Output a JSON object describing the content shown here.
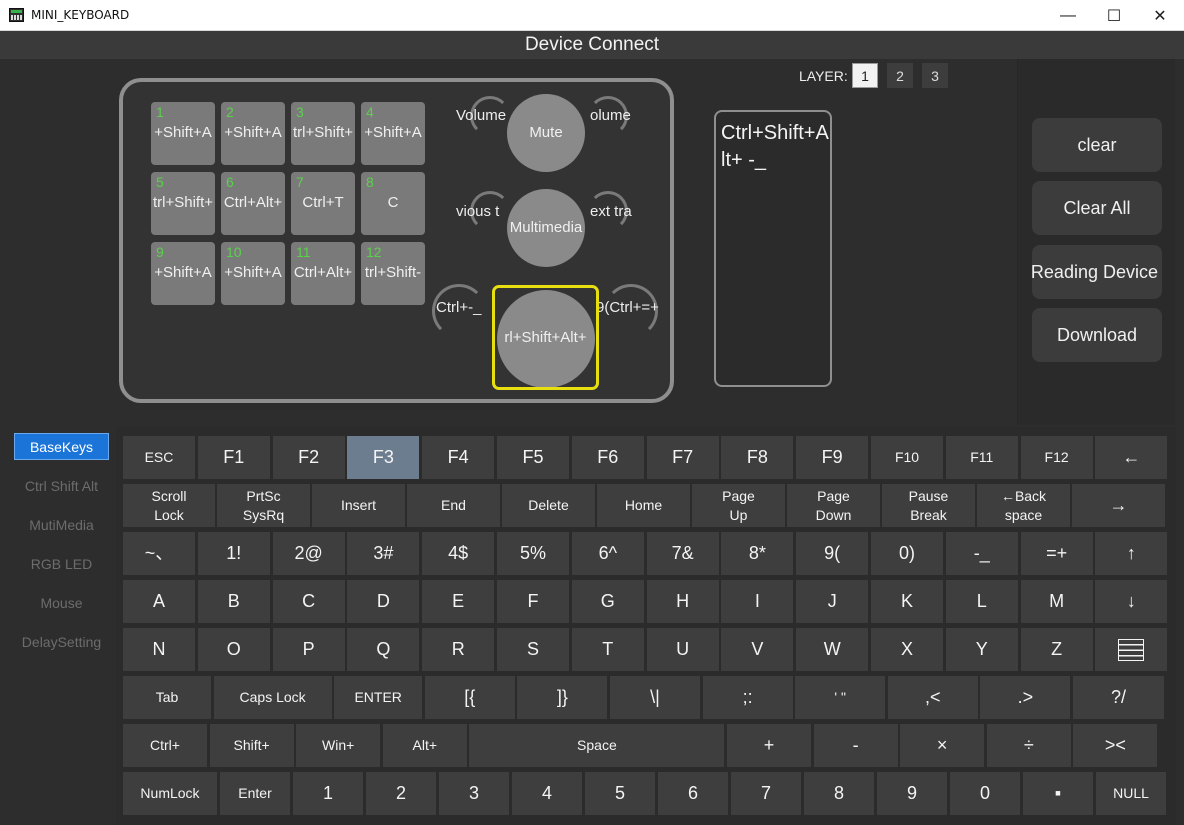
{
  "window": {
    "title": "MINI_KEYBOARD",
    "controls": {
      "minimize": "—",
      "maximize": "☐",
      "close": "✕"
    }
  },
  "header": {
    "title": "Device Connect"
  },
  "layer": {
    "label": "LAYER:",
    "options": [
      "1",
      "2",
      "3"
    ],
    "selected": "1"
  },
  "device": {
    "keys": [
      {
        "num": "1",
        "label": "+Shift+A"
      },
      {
        "num": "2",
        "label": "+Shift+A"
      },
      {
        "num": "3",
        "label": "trl+Shift+"
      },
      {
        "num": "4",
        "label": "+Shift+A"
      },
      {
        "num": "5",
        "label": "trl+Shift+"
      },
      {
        "num": "6",
        "label": "Ctrl+Alt+"
      },
      {
        "num": "7",
        "label": "Ctrl+T"
      },
      {
        "num": "8",
        "label": "C"
      },
      {
        "num": "9",
        "label": "+Shift+A"
      },
      {
        "num": "10",
        "label": "+Shift+A"
      },
      {
        "num": "11",
        "label": "Ctrl+Alt+"
      },
      {
        "num": "12",
        "label": "trl+Shift-"
      }
    ],
    "knobs": [
      {
        "left": "Volume",
        "center": "Mute",
        "right": "olume"
      },
      {
        "left": "vious t",
        "center": "Multimedia",
        "right": "ext tra"
      },
      {
        "left": "Ctrl+-_",
        "center": "rl+Shift+Alt+",
        "right": "9(Ctrl+=+"
      }
    ]
  },
  "preview": {
    "text": "Ctrl+Shift+Alt+ -_"
  },
  "actions": {
    "clear": "clear",
    "clear_all": "Clear All",
    "reading": "Reading Device",
    "download": "Download"
  },
  "sidebar": {
    "items": [
      "BaseKeys",
      "Ctrl Shift Alt",
      "MutiMedia",
      "RGB LED",
      "Mouse",
      "DelaySetting"
    ],
    "active": "BaseKeys"
  },
  "keyboard": {
    "selected": "F3",
    "rows": [
      [
        "ESC",
        "F1",
        "F2",
        "F3",
        "F4",
        "F5",
        "F6",
        "F7",
        "F8",
        "F9",
        "F10",
        "F11",
        "F12",
        "←"
      ],
      [
        "Scroll\nLock",
        "PrtSc\nSysRq",
        "Insert",
        "End",
        "Delete",
        "Home",
        "Page\nUp",
        "Page\nDown",
        "Pause\nBreak",
        "←Back\nspace",
        "→"
      ],
      [
        "~、",
        "1!",
        "2@",
        "3#",
        "4$",
        "5%",
        "6^",
        "7&",
        "8*",
        "9(",
        "0)",
        "-_",
        "=+",
        "↑"
      ],
      [
        "A",
        "B",
        "C",
        "D",
        "E",
        "F",
        "G",
        "H",
        "I",
        "J",
        "K",
        "L",
        "M",
        "↓"
      ],
      [
        "N",
        "O",
        "P",
        "Q",
        "R",
        "S",
        "T",
        "U",
        "V",
        "W",
        "X",
        "Y",
        "Z",
        ""
      ],
      [
        "Tab",
        "Caps Lock",
        "ENTER",
        "[{",
        "]}",
        "\\|",
        ";:",
        "' \"",
        ",<",
        ".>",
        "?/"
      ],
      [
        "Ctrl+",
        "Shift+",
        "Win+",
        "Alt+",
        "Space",
        "+",
        "-",
        "×",
        "÷",
        "><"
      ],
      [
        "NumLock",
        "Enter",
        "1",
        "2",
        "3",
        "4",
        "5",
        "6",
        "7",
        "8",
        "9",
        "0",
        "▪",
        "NULL"
      ]
    ]
  }
}
